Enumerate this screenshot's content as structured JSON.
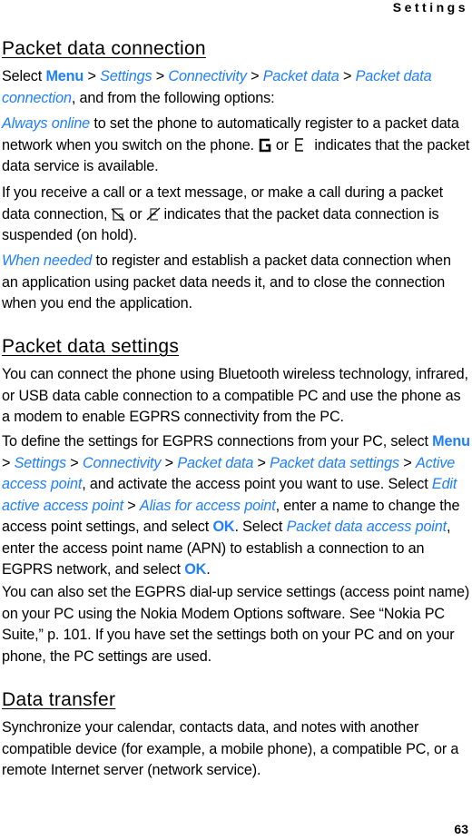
{
  "header": {
    "running_title": "Settings"
  },
  "sections": {
    "packet_data_connection": {
      "title": "Packet data connection",
      "intro": {
        "select": "Select ",
        "menu": "Menu",
        "sep": " > ",
        "path": [
          "Settings",
          "Connectivity",
          "Packet data",
          "Packet data connection"
        ],
        "tail": ", and from the following options:"
      },
      "always_online": {
        "term": "Always online",
        "text1": " to set the phone to automatically register to a packet data  network when you switch on the phone.",
        "or": "or",
        "text2": " indicates that the packet data service is available."
      },
      "suspended": {
        "text1": "If you receive a call or a text message, or make a call during a packet data  connection,",
        "or": "or",
        "text2": "indicates that the packet data connection is suspended (on hold)."
      },
      "when_needed": {
        "term": "When needed",
        "text": " to register and establish a packet data connection when an application using packet data  needs it, and to close the connection when you end the application."
      }
    },
    "packet_data_settings": {
      "title": "Packet data settings",
      "para1": "You can connect the phone using Bluetooth wireless technology, infrared, or USB data cable connection to a compatible PC and use the phone as a modem to enable EGPRS connectivity from the PC.",
      "para2": {
        "lead": "To define the settings for EGPRS connections from your PC, select ",
        "menu": "Menu",
        "sep": " > ",
        "path": [
          "Settings",
          "Connectivity",
          "Packet data",
          "Packet data settings",
          "Active access point"
        ],
        "t1": ", and activate the access point you want to use. Select ",
        "edit": "Edit active access point",
        "alias": "Alias for access point",
        "t2": ", enter a name to change the access point settings, and select ",
        "ok": "OK",
        "t3": ". Select ",
        "apn": "Packet data access point",
        "t4": ", enter the access point name (APN) to establish a connection to an EGPRS network, and select ",
        "t5": "."
      },
      "para3": "You can also set the EGPRS dial-up service settings (access point name) on your PC using the Nokia Modem Options software. See “Nokia PC Suite,” p. 101. If you have set the settings both on your PC and on your phone, the PC settings are used."
    },
    "data_transfer": {
      "title": "Data transfer",
      "para1": "Synchronize your calendar, contacts data, and notes with another compatible device (for example, a mobile phone), a compatible PC, or a remote Internet server (network service)."
    }
  },
  "icons": {
    "gprs": "gprs-available-icon",
    "egprs": "egprs-available-icon",
    "gprs_hold": "gprs-suspended-icon",
    "egprs_hold": "egprs-suspended-icon"
  },
  "colors": {
    "link": "#1e7fff",
    "text": "#000000"
  },
  "footer": {
    "page_number": "63"
  }
}
